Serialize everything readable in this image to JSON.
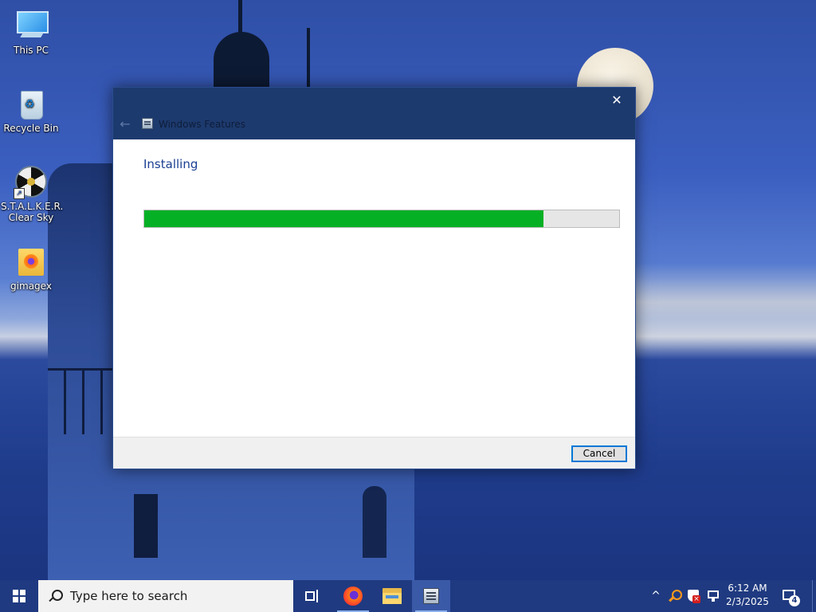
{
  "desktop": {
    "icons": [
      {
        "label": "This PC",
        "icon": "computer-icon"
      },
      {
        "label": "Recycle Bin",
        "icon": "recycle-bin-icon"
      },
      {
        "label": "S.T.A.L.K.E.R. Clear Sky",
        "icon": "game-shortcut-icon"
      },
      {
        "label": "gimagex",
        "icon": "folder-app-icon"
      }
    ]
  },
  "dialog": {
    "title": "Windows Features",
    "back_icon": "back-arrow-icon",
    "close_icon": "close-icon",
    "heading": "Installing",
    "progress": 0.84,
    "progress_color": "#06b025",
    "cancel_label": "Cancel"
  },
  "taskbar": {
    "search_placeholder": "Type here to search",
    "pinned": [
      "task-view-icon",
      "firefox-icon",
      "file-explorer-icon",
      "windows-features-icon"
    ],
    "tray": {
      "chevron": "^",
      "icons": [
        "key-icon",
        "security-shield-icon",
        "network-icon"
      ]
    },
    "clock": {
      "time": "6:12 AM",
      "date": "2/3/2025"
    },
    "notification_count": "4"
  }
}
